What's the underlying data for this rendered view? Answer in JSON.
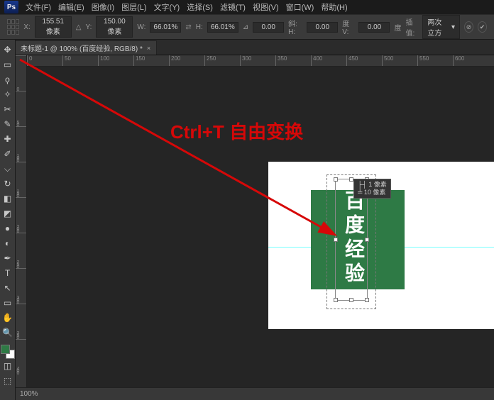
{
  "menubar": {
    "items": [
      "文件(F)",
      "编辑(E)",
      "图像(I)",
      "图层(L)",
      "文字(Y)",
      "选择(S)",
      "滤镜(T)",
      "视图(V)",
      "窗口(W)",
      "帮助(H)"
    ]
  },
  "options": {
    "x_label": "X:",
    "x_value": "155.51 像素",
    "y_label": "Y:",
    "y_value": "150.00 像素",
    "w_label": "W:",
    "w_value": "66.01%",
    "h_label": "H:",
    "h_value": "66.01%",
    "rotate_label": "⊿",
    "rotate_value": "0.00",
    "skewh_label": "斜: H:",
    "skewh_value": "0.00",
    "skewv_label": "度   V:",
    "skewv_value": "0.00",
    "skew_unit": "度",
    "interp_label": "插值:",
    "interp_value": "两次立方"
  },
  "tab": {
    "title": "未标题-1 @ 100% (百度经验, RGB/8) *"
  },
  "ruler_marks_h": [
    "0",
    "50",
    "100",
    "150",
    "200",
    "250",
    "300",
    "350",
    "400",
    "450",
    "500",
    "550",
    "600"
  ],
  "ruler_marks_v": [
    "0",
    "50",
    "100",
    "150",
    "200",
    "250",
    "300",
    "350",
    "400"
  ],
  "annotation": {
    "text": "Ctrl+T   自由变换"
  },
  "doc": {
    "vertical_text": "百度经验"
  },
  "info_tip": {
    "l1": "├┤ 1 像素",
    "l2": "╧  10 像素"
  },
  "status": {
    "text": "100%"
  }
}
